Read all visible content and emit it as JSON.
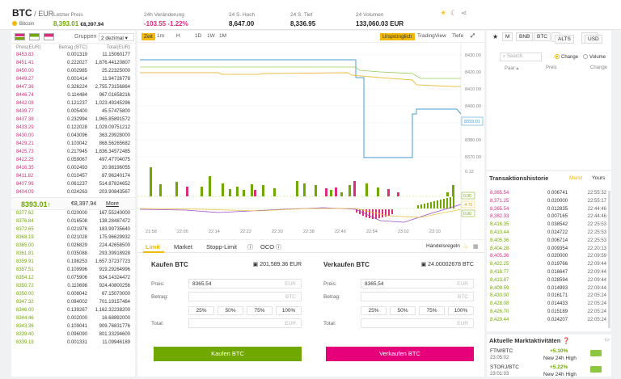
{
  "header": {
    "base": "BTC",
    "quote": "EUR",
    "coin": "Bitcoin",
    "price": "8,393.01",
    "price_eur": "€8,397.94",
    "stats": [
      {
        "label": "Letzter Preis",
        "value": "8,393.01 €8,397.94"
      },
      {
        "label": "24h Veränderung",
        "value": "-103.55 -1.22%"
      },
      {
        "label": "24 S. Hoch",
        "value": "8,647.00"
      },
      {
        "label": "24 S. Tief",
        "value": "8,336.95"
      },
      {
        "label": "24 Volumen",
        "value": "133,060.03 EUR"
      }
    ]
  },
  "orderbook": {
    "groups_label": "Gruppen",
    "groups_value": "2 dezimal",
    "headers": [
      "Preis(EUR)",
      "Betrag (BTC)",
      "Total(EUR)"
    ],
    "asks": [
      [
        "8453.83",
        "0.001319",
        "11.15060177"
      ],
      [
        "8451.41",
        "0.222027",
        "1,876.44120807"
      ],
      [
        "8450.00",
        "0.002985",
        "25.22325000"
      ],
      [
        "8449.27",
        "0.001414",
        "11.94726778"
      ],
      [
        "8447.36",
        "0.326224",
        "2,755.73156864"
      ],
      [
        "8446.74",
        "0.114484",
        "967.01658216"
      ],
      [
        "8442.08",
        "0.121237",
        "1,023.49245296"
      ],
      [
        "8439.77",
        "0.005400",
        "45.57475800"
      ],
      [
        "8437.38",
        "0.232994",
        "1,965.85891572"
      ],
      [
        "8433.29",
        "0.122028",
        "1,029.09751212"
      ],
      [
        "8430.00",
        "0.043096",
        "363.29928000"
      ],
      [
        "8429.21",
        "0.103042",
        "868.56265682"
      ],
      [
        "8425.73",
        "0.217945",
        "1,836.34572485"
      ],
      [
        "8422.25",
        "0.059067",
        "497.47704075"
      ],
      [
        "8416.35",
        "0.002493",
        "20.98196055"
      ],
      [
        "8411.82",
        "0.010457",
        "87.96240174"
      ],
      [
        "8407.96",
        "0.061237",
        "514.87824652"
      ],
      [
        "8404.09",
        "0.024263",
        "203.90843567"
      ]
    ],
    "mid_price": "8393.01↑",
    "mid_eur": "€8,397.94",
    "more": "More",
    "bids": [
      [
        "8377.62",
        "0.020000",
        "167.55240000"
      ],
      [
        "8376.84",
        "0.016508",
        "138.28487472"
      ],
      [
        "8372.65",
        "0.021976",
        "183.99735640"
      ],
      [
        "8368.19",
        "0.021028",
        "175.96629932"
      ],
      [
        "8365.00",
        "0.026829",
        "224.42658500"
      ],
      [
        "8361.81",
        "0.035088",
        "293.39918928"
      ],
      [
        "8359.91",
        "0.198253",
        "1,657.37237723"
      ],
      [
        "8357.51",
        "0.109996",
        "919.29264996"
      ],
      [
        "8354.12",
        "0.075906",
        "634.14324472"
      ],
      [
        "8350.72",
        "0.110698",
        "924.40800256"
      ],
      [
        "8350.00",
        "0.008042",
        "67.15070000"
      ],
      [
        "8347.32",
        "0.084002",
        "701.19157464"
      ],
      [
        "8346.00",
        "0.139267",
        "1,162.32238200"
      ],
      [
        "8344.46",
        "0.002000",
        "16.68892000"
      ],
      [
        "8343.36",
        "0.109041",
        "909.76831776"
      ],
      [
        "8339.40",
        "0.096090",
        "801.33294600"
      ],
      [
        "8339.19",
        "0.001331",
        "11.09946189"
      ]
    ]
  },
  "chart": {
    "time_label": "Zeit",
    "intervals": [
      "1m",
      "H",
      "1D",
      "1W",
      "1M"
    ],
    "views": [
      "Ursprünglich",
      "TradingView",
      "Tiefe"
    ],
    "y_ticks": [
      "8430.00",
      "8420.00",
      "8410.00",
      "8400.00",
      "8390.00",
      "8380.00",
      "8370.00",
      "0.12"
    ],
    "price_tag": "8393.01",
    "macd_ticks": [
      "0.00",
      "-4.70",
      "0.00"
    ],
    "x_ticks": [
      "21:58",
      "22:06",
      "22:14",
      "22:22",
      "22:30",
      "22:38",
      "22:46",
      "22:54",
      "23:02",
      "23:10"
    ]
  },
  "orders": {
    "tabs": [
      "Limit",
      "Market",
      "Stopp-Limit",
      "OCO"
    ],
    "rules": "Handelsregeln",
    "buy": {
      "title": "Kaufen BTC",
      "balance": "201,589.36 EUR",
      "price_label": "Preis:",
      "price": "8365,54",
      "price_unit": "EUR",
      "amount_label": "Betrag:",
      "amount_unit": "BTC",
      "pcts": [
        "25%",
        "50%",
        "75%",
        "100%"
      ],
      "total_label": "Total:",
      "total_unit": "EUR",
      "button": "Kaufen BTC"
    },
    "sell": {
      "title": "Verkaufen BTC",
      "balance": "24.00002678 BTC",
      "price_label": "Preis:",
      "price": "8365,54",
      "price_unit": "EUR",
      "amount_label": "Betrag:",
      "amount_unit": "BTC",
      "pcts": [
        "25%",
        "50%",
        "75%",
        "100%"
      ],
      "total_label": "Total:",
      "total_unit": "EUR",
      "button": "Verkaufen BTC"
    }
  },
  "markets": {
    "tabs": [
      "M",
      "BNB",
      "BTC",
      "ALTS",
      "USD"
    ],
    "search": "Search",
    "change": "Change",
    "volume": "Volume",
    "col_pair": "Paar",
    "col_price": "Preis",
    "col_change": "Change"
  },
  "trades": {
    "title": "Transaktionshistorie",
    "tab_market": "Markt",
    "tab_yours": "Yours",
    "rows": [
      [
        "8,365.54",
        "0.006741",
        "22:55:32",
        "r"
      ],
      [
        "8,371.25",
        "0.020000",
        "22:55:17",
        "r"
      ],
      [
        "8,365.54",
        "0.012835",
        "22:44:46",
        "r"
      ],
      [
        "8,382.33",
        "0.007165",
        "22:44:46",
        "r"
      ],
      [
        "8,416.35",
        "0.038542",
        "22:25:53",
        "g"
      ],
      [
        "8,410.44",
        "0.024722",
        "22:25:53",
        "g"
      ],
      [
        "8,405.36",
        "0.006714",
        "22:25:53",
        "g"
      ],
      [
        "8,404.28",
        "0.009354",
        "22:20:13",
        "g"
      ],
      [
        "8,405.36",
        "0.020000",
        "22:09:59",
        "r"
      ],
      [
        "8,422.25",
        "0.019766",
        "22:09:44",
        "g"
      ],
      [
        "8,418.77",
        "0.016647",
        "22:09:44",
        "g"
      ],
      [
        "8,413.87",
        "0.028594",
        "22:09:44",
        "g"
      ],
      [
        "8,409.59",
        "0.014993",
        "22:09:44",
        "g"
      ],
      [
        "8,430.00",
        "0.016171",
        "22:05:24",
        "g"
      ],
      [
        "8,428.08",
        "0.014433",
        "22:05:24",
        "g"
      ],
      [
        "8,426.70",
        "0.015189",
        "22:05:24",
        "g"
      ],
      [
        "8,420.44",
        "0.024207",
        "22:05:24",
        "g"
      ]
    ]
  },
  "activity": {
    "title": "Aktuelle Marktaktivitäten",
    "rows": [
      {
        "pair": "FTM/BTC",
        "time": "23:05:02",
        "pct": "+5.10%",
        "desc": "New 24h High"
      },
      {
        "pair": "STORJ/BTC",
        "time": "23:01:03",
        "pct": "+5.22%",
        "desc": "New 24h High"
      }
    ]
  }
}
